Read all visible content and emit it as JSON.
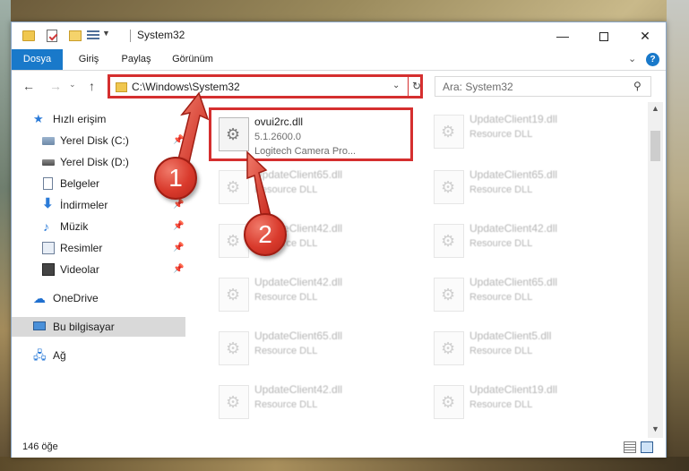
{
  "window": {
    "title": "System32"
  },
  "ribbon": {
    "tabs": [
      {
        "label": "Dosya"
      },
      {
        "label": "Giriş"
      },
      {
        "label": "Paylaş"
      },
      {
        "label": "Görünüm"
      }
    ],
    "help_label": "?"
  },
  "nav": {
    "address": "C:\\Windows\\System32",
    "search_placeholder": "Ara: System32"
  },
  "sidebar": {
    "items": [
      {
        "label": "Hızlı erişim",
        "icon": "star-icon",
        "pinned": false
      },
      {
        "label": "Yerel Disk (C:)",
        "icon": "disk-icon",
        "pinned": true
      },
      {
        "label": "Yerel Disk (D:)",
        "icon": "disk-icon",
        "pinned": true
      },
      {
        "label": "Belgeler",
        "icon": "document-icon",
        "pinned": true
      },
      {
        "label": "İndirmeler",
        "icon": "download-icon",
        "pinned": true
      },
      {
        "label": "Müzik",
        "icon": "music-icon",
        "pinned": true
      },
      {
        "label": "Resimler",
        "icon": "pictures-icon",
        "pinned": true
      },
      {
        "label": "Videolar",
        "icon": "video-icon",
        "pinned": true
      },
      {
        "label": "OneDrive",
        "icon": "cloud-icon",
        "pinned": false
      },
      {
        "label": "Bu bilgisayar",
        "icon": "computer-icon",
        "pinned": false,
        "selected": true
      },
      {
        "label": "Ağ",
        "icon": "network-icon",
        "pinned": false
      }
    ]
  },
  "files": {
    "selected": {
      "name": "ovui2rc.dll",
      "version": "5.1.2600.0",
      "description": "Logitech Camera Pro..."
    },
    "left_column": [
      {
        "name": "UpdateClient65.dll",
        "description": "Resource DLL"
      },
      {
        "name": "UpdateClient42.dll",
        "description": "Resource DLL"
      },
      {
        "name": "UpdateClient42.dll",
        "description": "Resource DLL"
      },
      {
        "name": "UpdateClient65.dll",
        "description": "Resource DLL"
      },
      {
        "name": "UpdateClient42.dll",
        "description": "Resource DLL"
      }
    ],
    "right_column": [
      {
        "name": "UpdateClient19.dll",
        "description": "Resource DLL"
      },
      {
        "name": "UpdateClient65.dll",
        "description": "Resource DLL"
      },
      {
        "name": "UpdateClient42.dll",
        "description": "Resource DLL"
      },
      {
        "name": "UpdateClient65.dll",
        "description": "Resource DLL"
      },
      {
        "name": "UpdateClient5.dll",
        "description": "Resource DLL"
      },
      {
        "name": "UpdateClient19.dll",
        "description": "Resource DLL"
      }
    ]
  },
  "status": {
    "count": "146 öğe"
  },
  "annotations": {
    "step1": "1",
    "step2": "2",
    "color": "#d52f2f"
  },
  "colors": {
    "accent": "#1979ca",
    "highlight": "#d52f2f"
  }
}
